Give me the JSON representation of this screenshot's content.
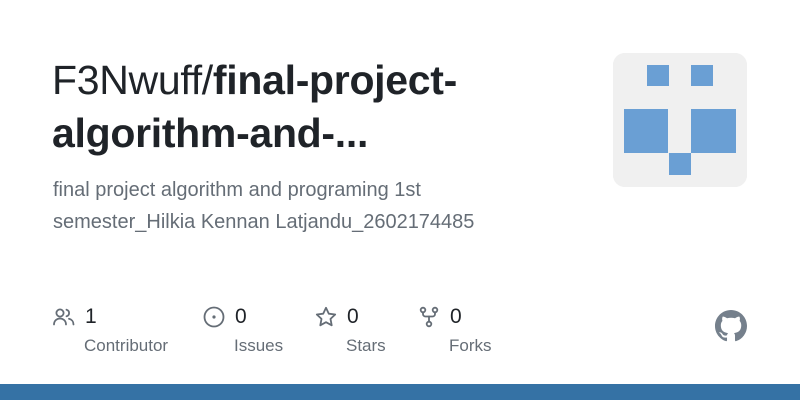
{
  "repo": {
    "owner_with_slash": "F3Nwuff/",
    "name_line1": "final-project-",
    "name_line2": "algorithm-and-...",
    "description_line1": "final project algorithm and programing 1st",
    "description_line2": "semester_Hilkia Kennan Latjandu_2602174485"
  },
  "stats": {
    "contributors": {
      "value": "1",
      "label": "Contributor",
      "icon": "people-icon"
    },
    "issues": {
      "value": "0",
      "label": "Issues",
      "icon": "issue-opened-icon"
    },
    "stars": {
      "value": "0",
      "label": "Stars",
      "icon": "star-icon"
    },
    "forks": {
      "value": "0",
      "label": "Forks",
      "icon": "repo-forked-icon"
    }
  },
  "avatar": {
    "icon": "identicon",
    "color": "#6a9fd4",
    "background": "#f0f0f0"
  },
  "brand": {
    "icon": "github-mark-icon",
    "color": "#75808c"
  },
  "colors": {
    "title": "#1f2328",
    "muted": "#656d76",
    "icon": "#656d76",
    "bar_primary": "#3572a5",
    "bar_secondary": "#2f6794"
  }
}
